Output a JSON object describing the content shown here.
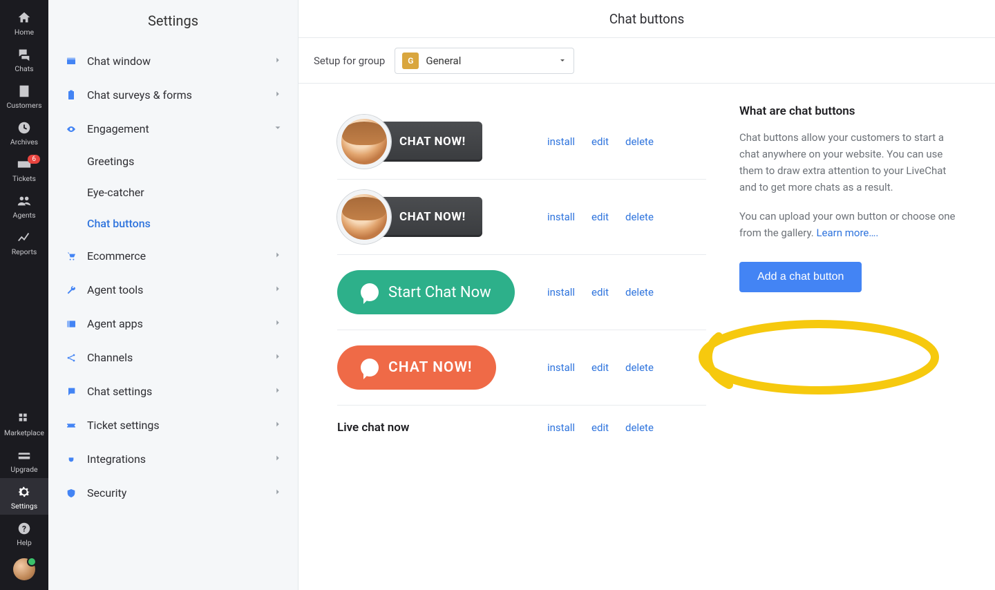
{
  "rail": {
    "items": [
      {
        "name": "home",
        "label": "Home"
      },
      {
        "name": "chats",
        "label": "Chats"
      },
      {
        "name": "customers",
        "label": "Customers"
      },
      {
        "name": "archives",
        "label": "Archives"
      },
      {
        "name": "tickets",
        "label": "Tickets",
        "badge": "6"
      },
      {
        "name": "agents",
        "label": "Agents"
      },
      {
        "name": "reports",
        "label": "Reports"
      }
    ],
    "bottom": [
      {
        "name": "marketplace",
        "label": "Marketplace"
      },
      {
        "name": "upgrade",
        "label": "Upgrade"
      },
      {
        "name": "settings",
        "label": "Settings",
        "active": true
      },
      {
        "name": "help",
        "label": "Help"
      }
    ]
  },
  "subnav": {
    "title": "Settings",
    "items": [
      {
        "label": "Chat window",
        "icon": "window",
        "color": "#4384f4"
      },
      {
        "label": "Chat surveys & forms",
        "icon": "clipboard",
        "color": "#4384f4"
      },
      {
        "label": "Engagement",
        "icon": "eye",
        "color": "#4384f4",
        "expanded": true,
        "children": [
          {
            "label": "Greetings"
          },
          {
            "label": "Eye-catcher"
          },
          {
            "label": "Chat buttons",
            "active": true
          }
        ]
      },
      {
        "label": "Ecommerce",
        "icon": "cart",
        "color": "#4384f4"
      },
      {
        "label": "Agent tools",
        "icon": "wrench",
        "color": "#4384f4"
      },
      {
        "label": "Agent apps",
        "icon": "panel",
        "color": "#4384f4"
      },
      {
        "label": "Channels",
        "icon": "share",
        "color": "#4384f4"
      },
      {
        "label": "Chat settings",
        "icon": "message",
        "color": "#4384f4"
      },
      {
        "label": "Ticket settings",
        "icon": "ticket",
        "color": "#4384f4"
      },
      {
        "label": "Integrations",
        "icon": "plug",
        "color": "#4384f4"
      },
      {
        "label": "Security",
        "icon": "shield",
        "color": "#4384f4"
      }
    ]
  },
  "page": {
    "title": "Chat buttons",
    "setup_label": "Setup for group",
    "group_letter": "G",
    "group_name": "General"
  },
  "buttons": [
    {
      "preview": "dark_face",
      "label": "CHAT NOW!",
      "install": "install",
      "edit": "edit",
      "delete": "delete"
    },
    {
      "preview": "dark_face",
      "label": "CHAT NOW!",
      "install": "install",
      "edit": "edit",
      "delete": "delete"
    },
    {
      "preview": "green_pill",
      "label": "Start Chat Now",
      "install": "install",
      "edit": "edit",
      "delete": "delete"
    },
    {
      "preview": "orange_pill",
      "label": "CHAT NOW!",
      "install": "install",
      "edit": "edit",
      "delete": "delete"
    },
    {
      "preview": "text",
      "label": "Live chat now",
      "install": "install",
      "edit": "edit",
      "delete": "delete"
    }
  ],
  "info": {
    "title": "What are chat buttons",
    "p1": "Chat buttons allow your customers to start a chat anywhere on your website. You can use them to draw extra attention to your LiveChat and to get more chats as a result.",
    "p2": "You can upload your own button or choose one from the gallery. ",
    "learn_more": "Learn more….",
    "add_label": "Add a chat button"
  }
}
